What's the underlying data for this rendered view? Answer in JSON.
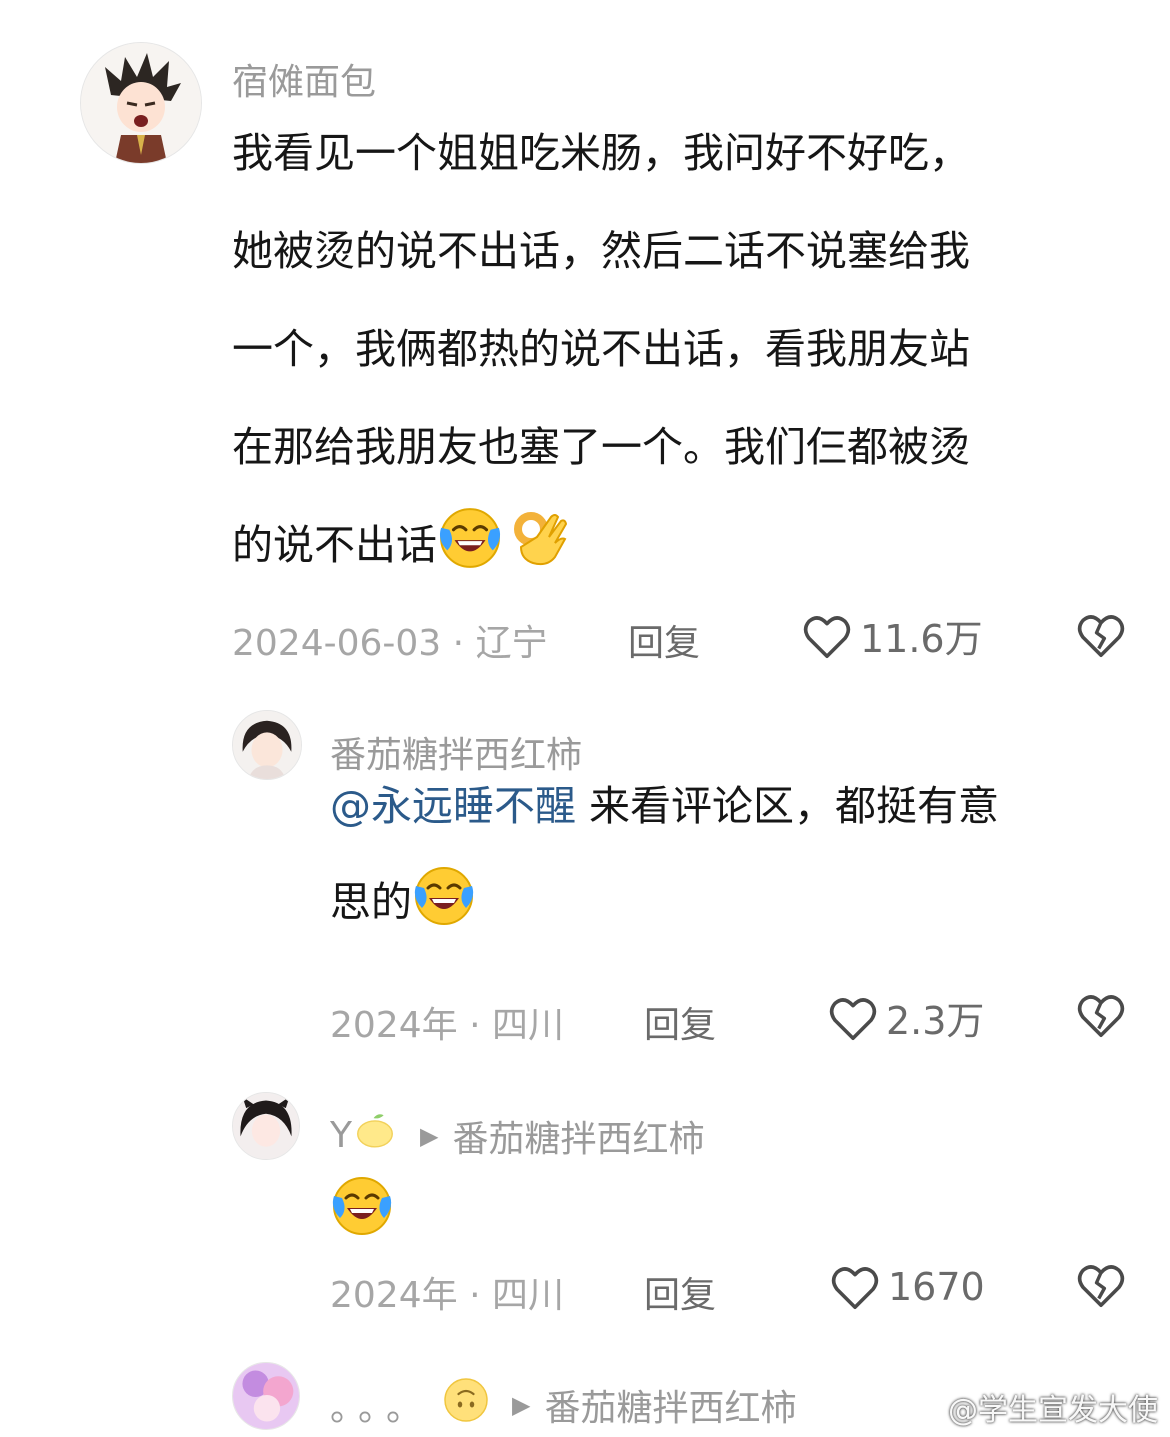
{
  "comments": [
    {
      "username": "宿傩面包",
      "lines": [
        "我看见一个姐姐吃米肠，我问好不好吃，",
        "她被烫的说不出话，然后二话不说塞给我",
        "一个，我俩都热的说不出话，看我朋友站",
        "在那给我朋友也塞了一个。我们仨都被烫",
        "的说不出话"
      ],
      "emojis": [
        "crying-laughing-emoji",
        "ok-hand-emoji"
      ],
      "date": "2024-06-03",
      "location": "辽宁",
      "reply_label": "回复",
      "likes": "11.6万"
    },
    {
      "username": "番茄糖拌西红柿",
      "mention": "@永远睡不醒",
      "lines": [
        "来看评论区，都挺有意",
        "思的"
      ],
      "emojis": [
        "crying-laughing-emoji"
      ],
      "date": "2024年",
      "location": "四川",
      "reply_label": "回复",
      "likes": "2.3万"
    },
    {
      "username": "Y",
      "username_emoji": "lemon-emoji",
      "reply_to": "番茄糖拌西红柿",
      "emojis": [
        "crying-laughing-emoji"
      ],
      "date": "2024年",
      "location": "四川",
      "reply_label": "回复",
      "likes": "1670"
    },
    {
      "username": "。。。",
      "username_emoji": "upside-down-face-emoji",
      "reply_to": "番茄糖拌西红柿"
    }
  ],
  "separator": "·",
  "watermark": "@学生宣发大使",
  "colors": {
    "username": "#9a9a9a",
    "mention": "#2b5a8a",
    "meta": "#a6a6a6",
    "text": "#161616"
  }
}
